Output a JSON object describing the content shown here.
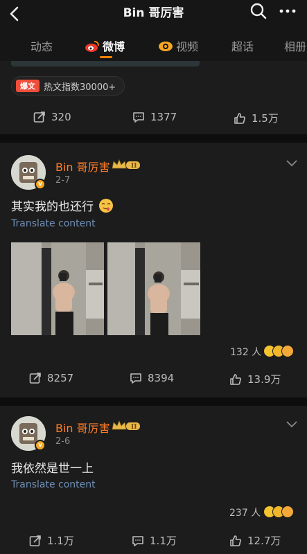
{
  "header": {
    "title": "Bin 哥厉害",
    "back_icon": "back-icon",
    "search_icon": "search-icon",
    "more_icon": "more-icon"
  },
  "tabs": [
    {
      "label": "动态"
    },
    {
      "label": "微博",
      "icon": "weibo-icon"
    },
    {
      "label": "视频",
      "icon": "video-icon"
    },
    {
      "label": "超话"
    },
    {
      "label": "相册"
    }
  ],
  "top_card": {
    "hot_badge": "爆文",
    "hot_text": "热文指数30000+",
    "reposts": "320",
    "comments": "1377",
    "likes": "1.5万"
  },
  "posts": [
    {
      "author": "Bin 哥厉害",
      "date": "2-7",
      "text": "其实我的也还行",
      "translate": "Translate content",
      "reactions": "132 人",
      "reposts": "8257",
      "comments": "8394",
      "likes": "13.9万"
    },
    {
      "author": "Bin 哥厉害",
      "date": "2-6",
      "text": "我依然是世一上",
      "translate": "Translate content",
      "reactions": "237 人",
      "reposts": "1.1万",
      "comments": "1.1万",
      "likes": "12.7万"
    }
  ],
  "colors": {
    "accent": "#ff8200",
    "username": "#ff7d2a",
    "translate": "#6f8fb8"
  }
}
